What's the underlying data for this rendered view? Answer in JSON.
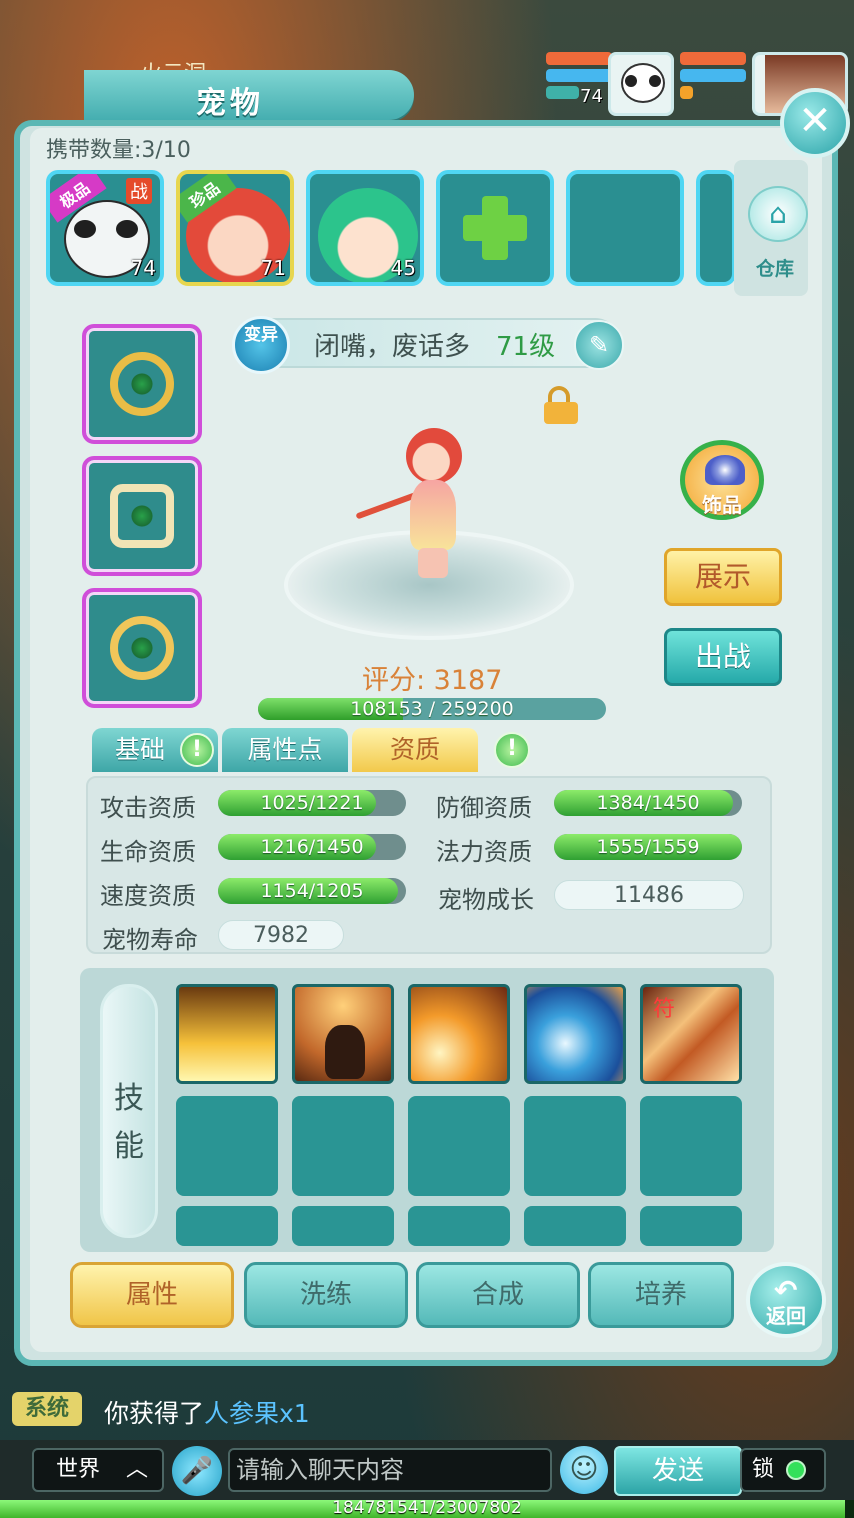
{
  "header": {
    "area_name": "火云洞",
    "title": "宠物",
    "hud_pet_level": "74"
  },
  "carry": {
    "label": "携带数量:3/10"
  },
  "pet_slots": [
    {
      "level": "74",
      "tag": "极品",
      "badge": "战",
      "color": "#e8f0f0"
    },
    {
      "level": "71",
      "tag": "珍品",
      "color": "#f5d3b5"
    },
    {
      "level": "45",
      "color": "#c8f0dd"
    }
  ],
  "warehouse": {
    "label": "仓库",
    "icon": "home-icon"
  },
  "pet": {
    "transform_label": "变异",
    "name": "闭嘴，废话多",
    "level": "71级",
    "score": "评分: 3187",
    "xp_text": "108153 / 259200",
    "xp_current": 108153,
    "xp_max": 259200
  },
  "accessory": {
    "label": "饰品"
  },
  "actions": {
    "show": "展示",
    "battle": "出战"
  },
  "tabs": [
    "基础",
    "属性点",
    "资质"
  ],
  "stats": {
    "attack": {
      "label": "攻击资质",
      "text": "1025/1221",
      "value": 1025,
      "max": 1221
    },
    "defense": {
      "label": "防御资质",
      "text": "1384/1450",
      "value": 1384,
      "max": 1450
    },
    "hp": {
      "label": "生命资质",
      "text": "1216/1450",
      "value": 1216,
      "max": 1450
    },
    "mana": {
      "label": "法力资质",
      "text": "1555/1559",
      "value": 1555,
      "max": 1559
    },
    "speed": {
      "label": "速度资质",
      "text": "1154/1205",
      "value": 1154,
      "max": 1205
    },
    "growth": {
      "label": "宠物成长",
      "value": "11486"
    },
    "lifespan": {
      "label": "宠物寿命",
      "value": "7982"
    }
  },
  "skills": {
    "label_1": "技",
    "label_2": "能",
    "icons": [
      "lightning-skill-icon",
      "shadow-cat-skill-icon",
      "meteor-skill-icon",
      "wave-skill-icon",
      "sand-talisman-skill-icon"
    ],
    "talisman_mark": "符"
  },
  "bottom_tabs": [
    "属性",
    "洗练",
    "合成",
    "培养"
  ],
  "back": {
    "label": "返回"
  },
  "chat": {
    "system_badge": "系统",
    "msg_prefix": "你获得了",
    "msg_item": "人参果x1",
    "channel": "世界",
    "input_placeholder": "请输入聊天内容",
    "send": "发送",
    "lock": "锁"
  },
  "footer_xp": {
    "text": "184781541/23007802",
    "fraction": 0.99
  }
}
